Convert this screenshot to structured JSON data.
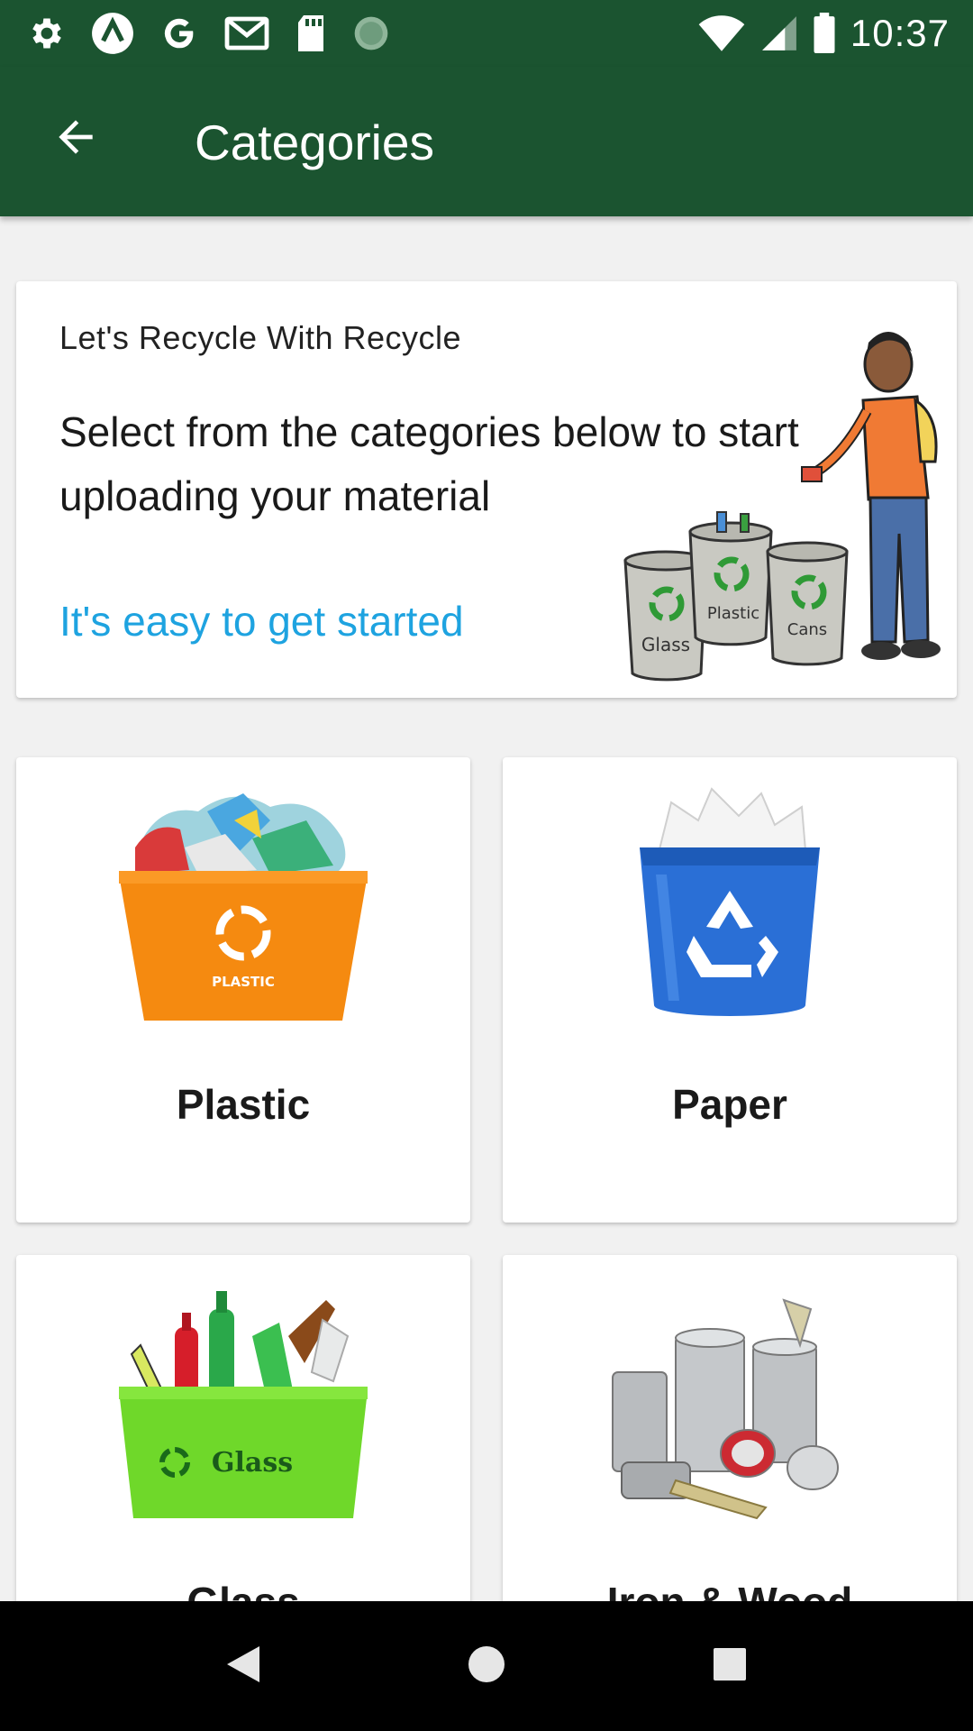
{
  "status_bar": {
    "time": "10:37",
    "left_icons": [
      "gear-icon",
      "nav-arrow-icon",
      "google-icon",
      "gmail-icon",
      "sd-card-icon",
      "loading-icon"
    ],
    "right_icons": [
      "wifi-icon",
      "signal-icon",
      "battery-icon"
    ]
  },
  "app_bar": {
    "title": "Categories",
    "back_icon": "arrow-left-icon"
  },
  "intro": {
    "heading": "Let's Recycle With Recycle",
    "body": "Select from the categories below to start uploading your material",
    "link": "It's easy to get started",
    "bin_labels": [
      "Glass",
      "Plastic",
      "Cans"
    ]
  },
  "categories": [
    {
      "label": "Plastic",
      "bin_text": "PLASTIC"
    },
    {
      "label": "Paper"
    },
    {
      "label": "Glass",
      "bin_text": "Glass"
    },
    {
      "label": "Iron & Wood"
    }
  ],
  "colors": {
    "primary": "#1b5430",
    "accent": "#1ea3e0",
    "background": "#f1f1f1"
  },
  "nav_bar": {
    "icons": [
      "back-triangle-icon",
      "home-circle-icon",
      "recents-square-icon"
    ]
  }
}
